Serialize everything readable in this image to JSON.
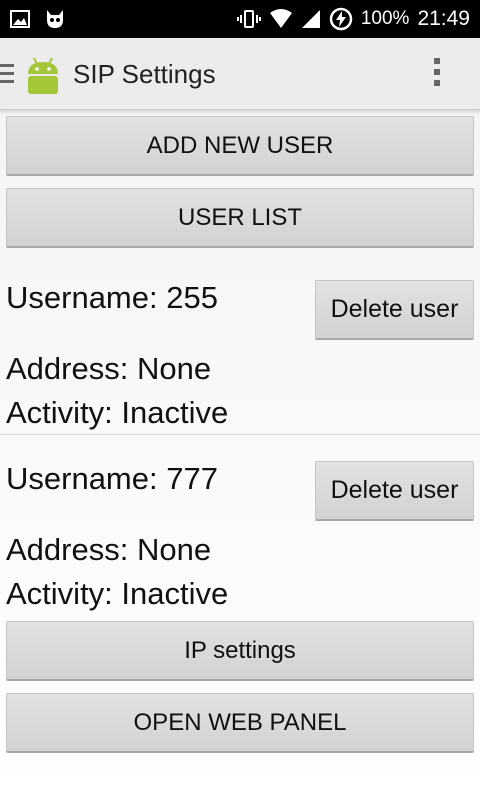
{
  "status_bar": {
    "icons_left": [
      "image-icon",
      "cat-icon"
    ],
    "icons_right": [
      "vibrate-icon",
      "wifi-icon",
      "signal-icon",
      "battery-charging-icon"
    ],
    "battery": "100%",
    "time": "21:49"
  },
  "action_bar": {
    "title": "SIP Settings"
  },
  "buttons": {
    "add_user": "ADD NEW USER",
    "user_list": "USER LIST",
    "ip_settings": "IP settings",
    "web_panel": "OPEN WEB PANEL"
  },
  "users": [
    {
      "username": "Username: 255",
      "address": "Address: None",
      "activity": "Activity: Inactive",
      "delete_label": "Delete user"
    },
    {
      "username": "Username: 777",
      "address": "Address: None",
      "activity": "Activity: Inactive",
      "delete_label": "Delete user"
    }
  ],
  "colors": {
    "status_bar_bg": "#000000",
    "action_bar_bg": "#ececec",
    "button_bg": "#d8d8d8",
    "logo_green": "#a4c639"
  }
}
